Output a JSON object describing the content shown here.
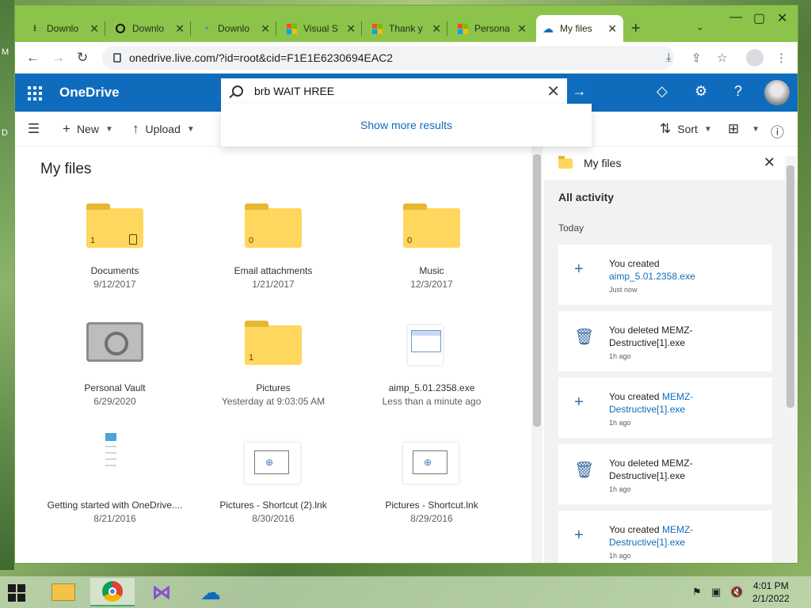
{
  "desktop": {
    "labels": [
      "M",
      "D"
    ]
  },
  "browser": {
    "tabs": [
      {
        "label": "Downlo",
        "icon": "download-icon"
      },
      {
        "label": "Downlo",
        "icon": "github-icon"
      },
      {
        "label": "Downlo",
        "icon": "edge-icon"
      },
      {
        "label": "Visual S",
        "icon": "microsoft-icon"
      },
      {
        "label": "Thank y",
        "icon": "microsoft-icon"
      },
      {
        "label": "Persona",
        "icon": "microsoft-icon"
      },
      {
        "label": "My files",
        "icon": "onedrive-icon"
      }
    ],
    "url": "onedrive.live.com/?id=root&cid=F1E1E6230694EAC2"
  },
  "onedrive": {
    "brand": "OneDrive",
    "search_value": "brb WAIT HREE",
    "show_more": "Show more results",
    "commands": {
      "new": "New",
      "upload": "Upload",
      "sort": "Sort"
    },
    "page_title": "My files",
    "items": [
      {
        "name": "Documents",
        "date": "9/12/2017",
        "kind": "folder",
        "count": "1"
      },
      {
        "name": "Email attachments",
        "date": "1/21/2017",
        "kind": "folder",
        "count": "0"
      },
      {
        "name": "Music",
        "date": "12/3/2017",
        "kind": "folder",
        "count": "0"
      },
      {
        "name": "Personal Vault",
        "date": "6/29/2020",
        "kind": "vault"
      },
      {
        "name": "Pictures",
        "date": "Yesterday at 9:03:05 AM",
        "kind": "folder",
        "count": "1"
      },
      {
        "name": "aimp_5.01.2358.exe",
        "date": "Less than a minute ago",
        "kind": "exe"
      },
      {
        "name": "Getting started with OneDrive....",
        "date": "8/21/2016",
        "kind": "doc"
      },
      {
        "name": "Pictures - Shortcut (2).lnk",
        "date": "8/30/2016",
        "kind": "lnk"
      },
      {
        "name": "Pictures - Shortcut.lnk",
        "date": "8/29/2016",
        "kind": "lnk"
      }
    ]
  },
  "activity": {
    "title": "My files",
    "all_activity": "All activity",
    "today": "Today",
    "cards": [
      {
        "icon": "plus-icon",
        "action": "You created",
        "file": "aimp_5.01.2358.exe",
        "time": "Just now"
      },
      {
        "icon": "trash-icon",
        "action": "You deleted MEMZ-Destructive[1].exe",
        "file": "",
        "time": "1h ago"
      },
      {
        "icon": "plus-icon",
        "action": "You created",
        "file": "MEMZ-Destructive[1].exe",
        "time": "1h ago"
      },
      {
        "icon": "trash-icon",
        "action": "You deleted MEMZ-Destructive[1].exe",
        "file": "",
        "time": "1h ago"
      },
      {
        "icon": "plus-icon",
        "action": "You created",
        "file": "MEMZ-Destructive[1].exe",
        "time": "1h ago"
      }
    ]
  },
  "taskbar": {
    "time": "4:01 PM",
    "date": "2/1/2022"
  }
}
